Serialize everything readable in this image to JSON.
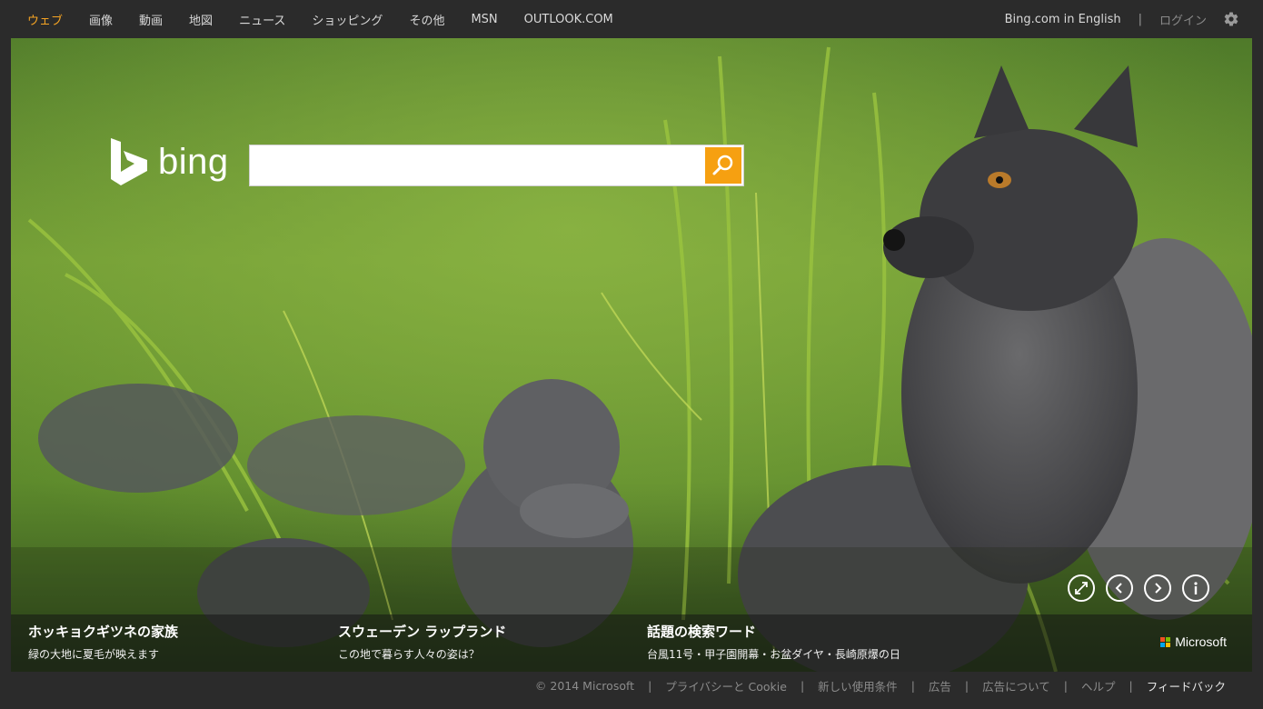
{
  "nav": {
    "items": [
      {
        "label": "ウェブ",
        "active": true
      },
      {
        "label": "画像"
      },
      {
        "label": "動画"
      },
      {
        "label": "地図"
      },
      {
        "label": "ニュース"
      },
      {
        "label": "ショッピング"
      },
      {
        "label": "その他"
      },
      {
        "label": "MSN"
      },
      {
        "label": "OUTLOOK.COM"
      }
    ],
    "english_link": "Bing.com in English",
    "separator": "|",
    "login": "ログイン",
    "settings_icon": "gear-icon"
  },
  "logo": {
    "text": "bing",
    "icon": "bing-b-icon"
  },
  "search": {
    "value": "",
    "placeholder": "",
    "button_icon": "search-icon"
  },
  "controls": [
    {
      "icon": "expand-icon"
    },
    {
      "icon": "chevron-left-icon"
    },
    {
      "icon": "chevron-right-icon"
    },
    {
      "icon": "info-icon"
    }
  ],
  "hotspots": [
    {
      "title": "ホッキョクギツネの家族",
      "subtitle": "緑の大地に夏毛が映えます"
    },
    {
      "title": "スウェーデン ラップランド",
      "subtitle": "この地で暮らす人々の姿は？"
    },
    {
      "title": "話題の検索ワード",
      "subtitle": "台風11号・甲子園開幕・お盆ダイヤ・長崎原爆の日"
    }
  ],
  "brand": {
    "label": "Microsoft"
  },
  "footer": {
    "items": [
      "© 2014 Microsoft",
      "プライバシーと Cookie",
      "新しい使用条件",
      "広告",
      "広告について",
      "ヘルプ",
      "フィードバック"
    ],
    "separator": "|"
  },
  "colors": {
    "accent": "#f6a423",
    "search_button": "#f6a011",
    "topbar": "#2b2b2b"
  }
}
